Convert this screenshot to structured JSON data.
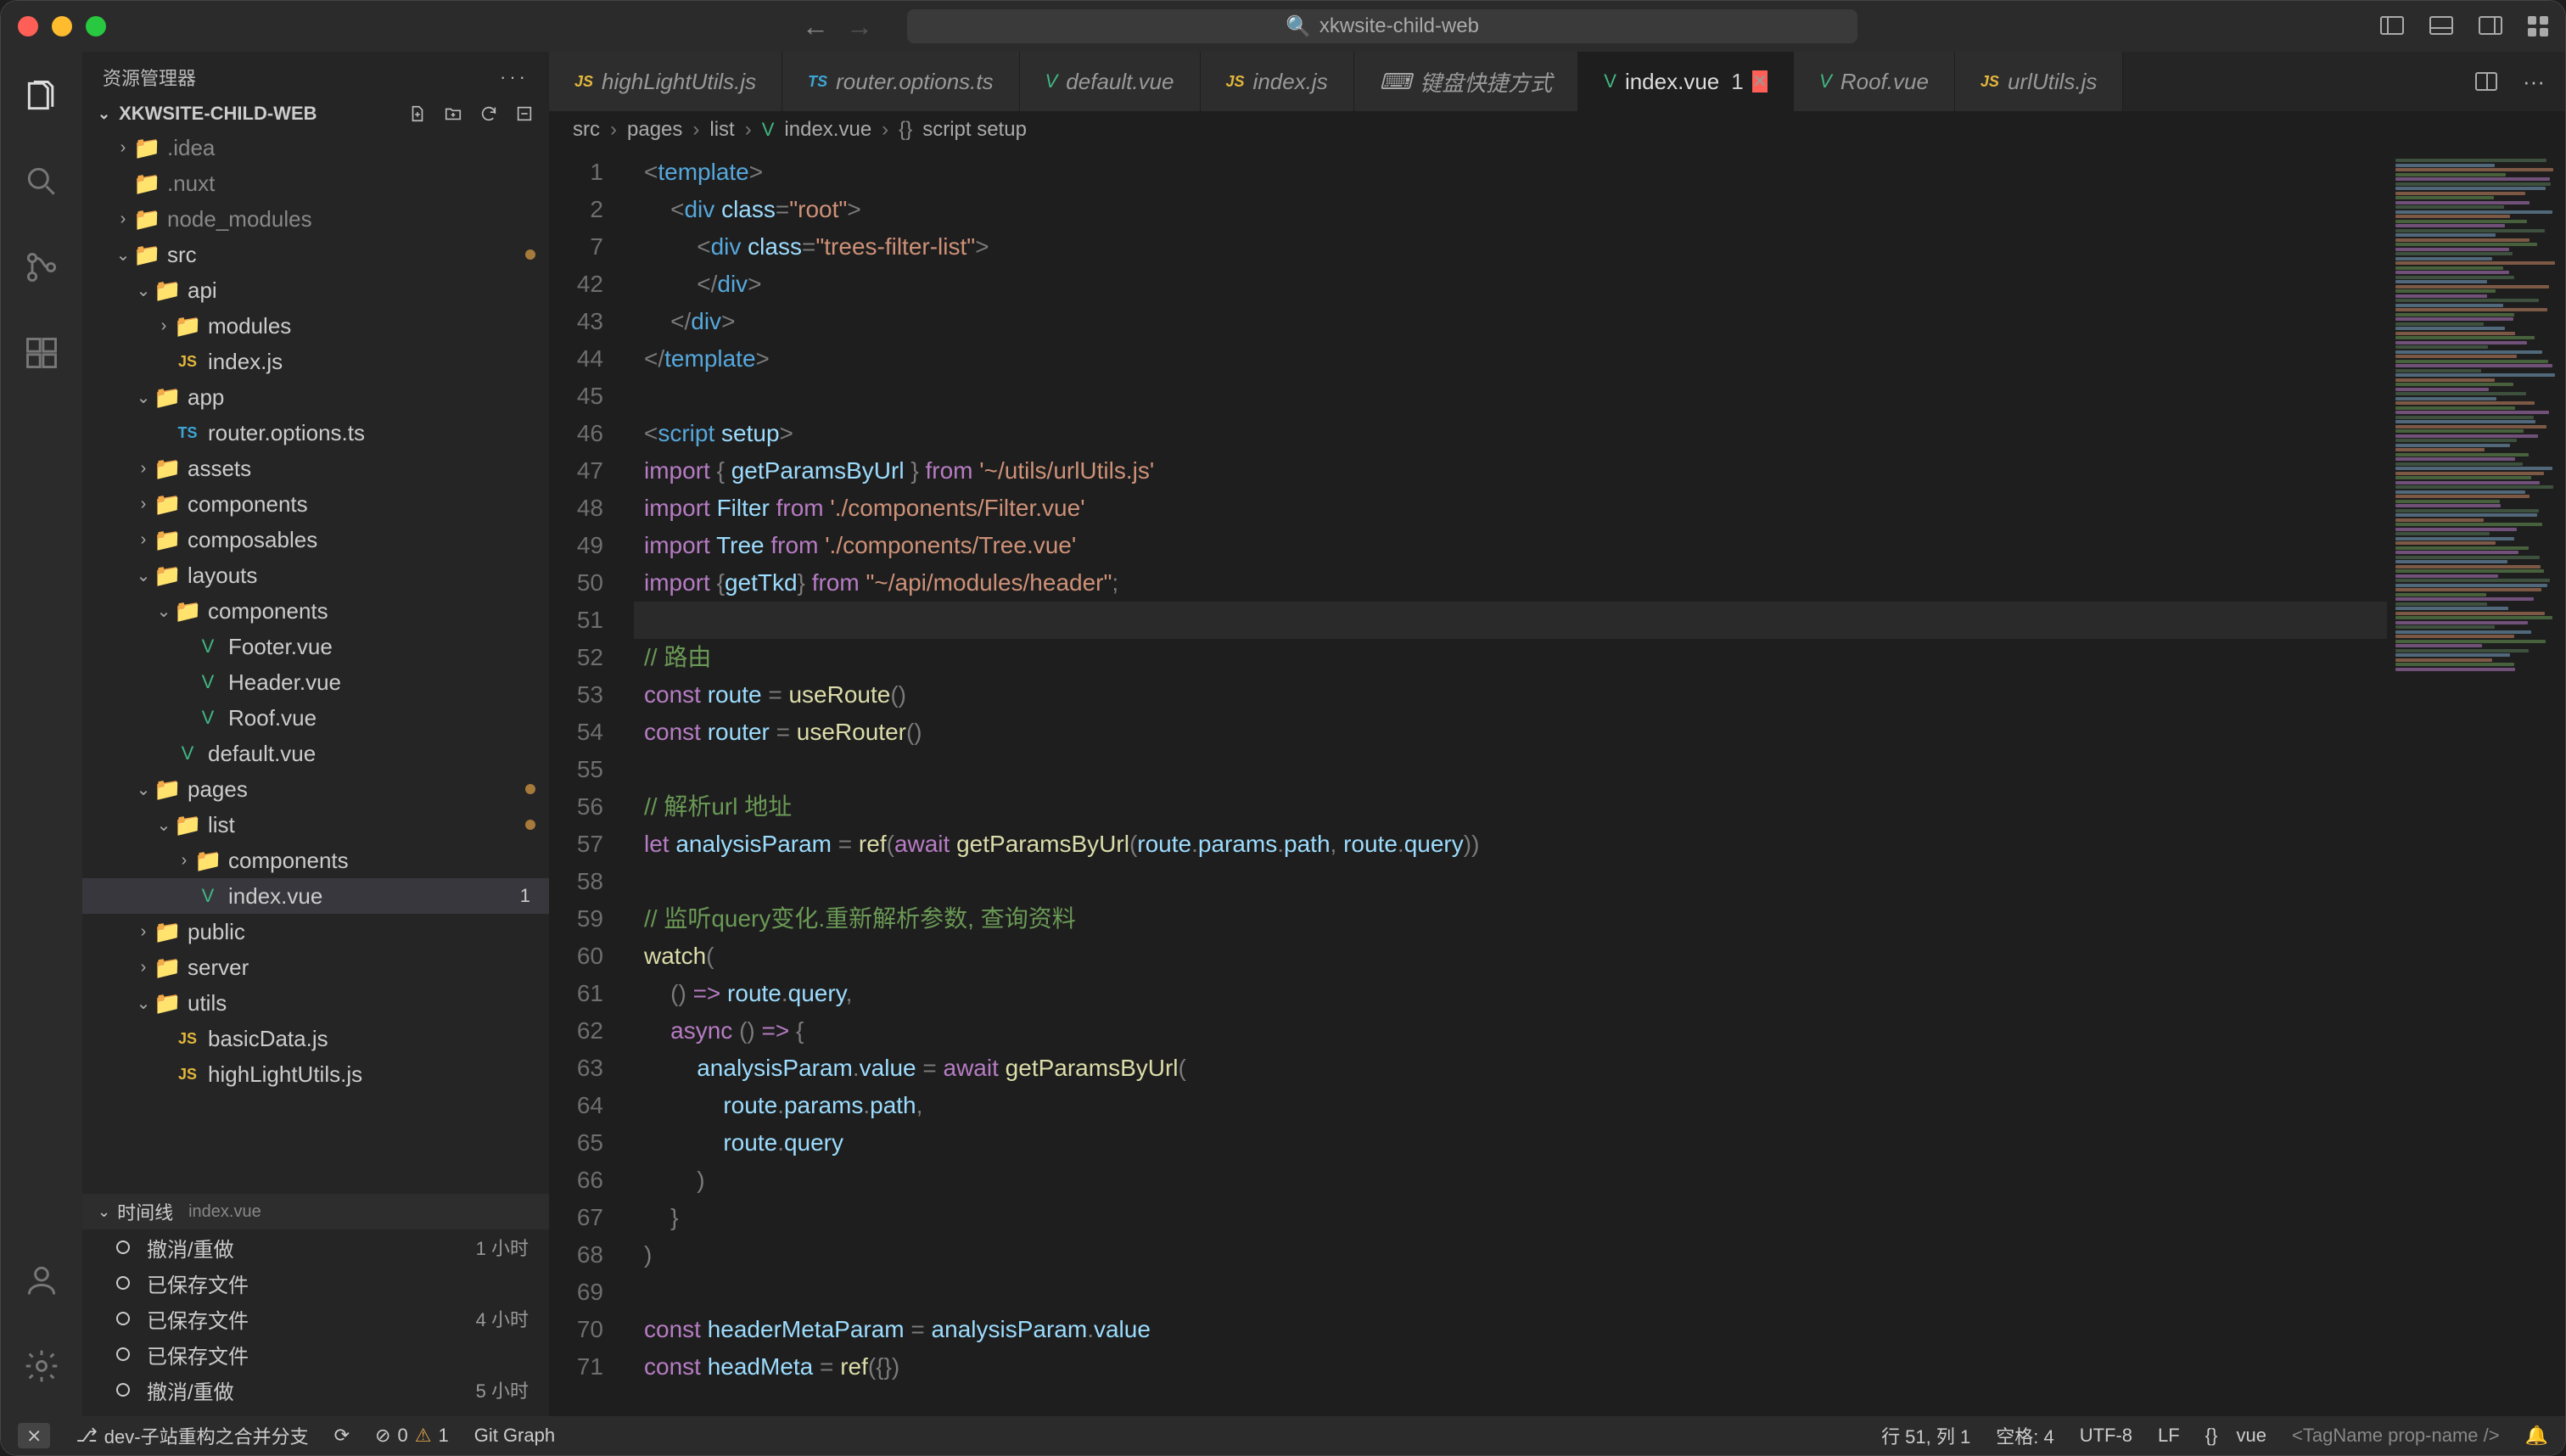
{
  "window": {
    "search_prefix": "🔍",
    "search_text": "xkwsite-child-web"
  },
  "sidebar": {
    "title": "资源管理器",
    "project": "XKWSITE-CHILD-WEB",
    "tree": [
      {
        "depth": 1,
        "chev": "›",
        "icon": "📁",
        "name": ".idea",
        "dim": true
      },
      {
        "depth": 1,
        "chev": "",
        "icon": "📁",
        "name": ".nuxt",
        "dim": true
      },
      {
        "depth": 1,
        "chev": "›",
        "icon": "📁",
        "name": "node_modules",
        "dim": true
      },
      {
        "depth": 1,
        "chev": "⌄",
        "icon": "📁",
        "name": "src",
        "mark": true,
        "color": "#7bbf5e"
      },
      {
        "depth": 2,
        "chev": "⌄",
        "icon": "📁",
        "name": "api"
      },
      {
        "depth": 3,
        "chev": "›",
        "icon": "📁",
        "name": "modules",
        "color": "#c76b6b"
      },
      {
        "depth": 3,
        "chev": "",
        "iconClass": "js-ic",
        "iconText": "JS",
        "name": "index.js"
      },
      {
        "depth": 2,
        "chev": "⌄",
        "icon": "📁",
        "name": "app"
      },
      {
        "depth": 3,
        "chev": "",
        "iconClass": "ts-ic",
        "iconText": "TS",
        "name": "router.options.ts"
      },
      {
        "depth": 2,
        "chev": "›",
        "icon": "📁",
        "name": "assets"
      },
      {
        "depth": 2,
        "chev": "›",
        "icon": "📁",
        "name": "components"
      },
      {
        "depth": 2,
        "chev": "›",
        "icon": "📁",
        "name": "composables"
      },
      {
        "depth": 2,
        "chev": "⌄",
        "icon": "📁",
        "name": "layouts",
        "color": "#d67a7a"
      },
      {
        "depth": 3,
        "chev": "⌄",
        "icon": "📁",
        "name": "components"
      },
      {
        "depth": 4,
        "chev": "",
        "iconClass": "vue-ic",
        "iconText": "V",
        "name": "Footer.vue"
      },
      {
        "depth": 4,
        "chev": "",
        "iconClass": "vue-ic",
        "iconText": "V",
        "name": "Header.vue"
      },
      {
        "depth": 4,
        "chev": "",
        "iconClass": "vue-ic",
        "iconText": "V",
        "name": "Roof.vue"
      },
      {
        "depth": 3,
        "chev": "",
        "iconClass": "vue-ic",
        "iconText": "V",
        "name": "default.vue"
      },
      {
        "depth": 2,
        "chev": "⌄",
        "icon": "📁",
        "name": "pages",
        "mark": true
      },
      {
        "depth": 3,
        "chev": "⌄",
        "icon": "📁",
        "name": "list",
        "mark": true
      },
      {
        "depth": 4,
        "chev": "›",
        "icon": "📁",
        "name": "components"
      },
      {
        "depth": 4,
        "chev": "",
        "iconClass": "vue-ic",
        "iconText": "V",
        "name": "index.vue",
        "selected": true,
        "badge": "1"
      },
      {
        "depth": 2,
        "chev": "›",
        "icon": "📁",
        "name": "public",
        "color": "#6aa66a"
      },
      {
        "depth": 2,
        "chev": "›",
        "icon": "📁",
        "name": "server"
      },
      {
        "depth": 2,
        "chev": "⌄",
        "icon": "📁",
        "name": "utils"
      },
      {
        "depth": 3,
        "chev": "",
        "iconClass": "js-ic",
        "iconText": "JS",
        "name": "basicData.js"
      },
      {
        "depth": 3,
        "chev": "",
        "iconClass": "js-ic",
        "iconText": "JS",
        "name": "highLightUtils.js"
      }
    ],
    "timeline": {
      "title": "时间线",
      "file": "index.vue",
      "items": [
        {
          "label": "撤消/重做",
          "when": "1 小时"
        },
        {
          "label": "已保存文件",
          "when": ""
        },
        {
          "label": "已保存文件",
          "when": "4 小时"
        },
        {
          "label": "已保存文件",
          "when": ""
        },
        {
          "label": "撤消/重做",
          "when": "5 小时"
        }
      ]
    }
  },
  "tabs": [
    {
      "iconClass": "js-ic",
      "iconText": "JS",
      "label": "highLightUtils.js"
    },
    {
      "iconClass": "ts-ic",
      "iconText": "TS",
      "label": "router.options.ts"
    },
    {
      "iconClass": "vue-ic",
      "iconText": "V",
      "label": "default.vue"
    },
    {
      "iconClass": "js-ic",
      "iconText": "JS",
      "label": "index.js"
    },
    {
      "iconClass": "kb-ic",
      "iconText": "⌨",
      "label": "键盘快捷方式"
    },
    {
      "iconClass": "vue-ic",
      "iconText": "V",
      "label": "index.vue",
      "mod": "1",
      "active": true,
      "close": true
    },
    {
      "iconClass": "vue-ic",
      "iconText": "V",
      "label": "Roof.vue"
    },
    {
      "iconClass": "js-ic",
      "iconText": "JS",
      "label": "urlUtils.js"
    }
  ],
  "breadcrumbs": [
    "src",
    "pages",
    "list",
    "index.vue",
    "script setup"
  ],
  "breadcrumbs_last_icon": "{}",
  "editor": {
    "gutter": [
      "1",
      "2",
      "7",
      "42",
      "43",
      "44",
      "45",
      "46",
      "47",
      "48",
      "49",
      "50",
      "51",
      "52",
      "53",
      "54",
      "55",
      "56",
      "57",
      "58",
      "59",
      "60",
      "61",
      "62",
      "63",
      "64",
      "65",
      "66",
      "67",
      "68",
      "69",
      "70",
      "71"
    ],
    "lines": [
      "<span class='p'>&lt;</span><span class='t'>template</span><span class='p'>&gt;</span>",
      "    <span class='p'>&lt;</span><span class='t'>div</span> <span class='a'>class</span><span class='p'>=</span><span class='s'>\"root\"</span><span class='p'>&gt;</span>",
      "        <span class='p'>&lt;</span><span class='t'>div</span> <span class='a'>class</span><span class='p'>=</span><span class='s'>\"trees-filter-list\"</span><span class='p'>&gt;</span>",
      "        <span class='p'>&lt;/</span><span class='t'>div</span><span class='p'>&gt;</span>",
      "    <span class='p'>&lt;/</span><span class='t'>div</span><span class='p'>&gt;</span>",
      "<span class='p'>&lt;/</span><span class='t'>template</span><span class='p'>&gt;</span>",
      "",
      "<span class='p'>&lt;</span><span class='t'>script</span> <span class='a'>setup</span><span class='p'>&gt;</span>",
      "<span class='k'>import</span> <span class='p'>{</span> <span class='v'>getParamsByUrl</span> <span class='p'>}</span> <span class='k'>from</span> <span class='s'>'~/utils/urlUtils.js'</span>",
      "<span class='k'>import</span> <span class='v'>Filter</span> <span class='k'>from</span> <span class='s'>'./components/Filter.vue'</span>",
      "<span class='k'>import</span> <span class='v'>Tree</span> <span class='k'>from</span> <span class='s'>'./components/Tree.vue'</span>",
      "<span class='k'>import</span> <span class='p'>{</span><span class='v'>getTkd</span><span class='p'>}</span> <span class='k'>from</span> <span class='s'>\"~/api/modules/header\"</span><span class='p'>;</span>",
      "",
      "<span class='c'>// 路由</span>",
      "<span class='k'>const</span> <span class='v'>route</span> <span class='p'>=</span> <span class='f'>useRoute</span><span class='p'>()</span>",
      "<span class='k'>const</span> <span class='v'>router</span> <span class='p'>=</span> <span class='f'>useRouter</span><span class='p'>()</span>",
      "",
      "<span class='c'>// 解析url 地址</span>",
      "<span class='k'>let</span> <span class='v'>analysisParam</span> <span class='p'>=</span> <span class='f'>ref</span><span class='p'>(</span><span class='k'>await</span> <span class='f'>getParamsByUrl</span><span class='p'>(</span><span class='v'>route</span><span class='p'>.</span><span class='v'>params</span><span class='p'>.</span><span class='v'>path</span><span class='p'>,</span> <span class='v'>route</span><span class='p'>.</span><span class='v'>query</span><span class='p'>))</span>",
      "",
      "<span class='c'>// 监听query变化.重新解析参数, 查询资料</span>",
      "<span class='f'>watch</span><span class='p'>(</span>",
      "    <span class='p'>()</span> <span class='k'>=&gt;</span> <span class='v'>route</span><span class='p'>.</span><span class='v'>query</span><span class='p'>,</span>",
      "    <span class='k'>async</span> <span class='p'>()</span> <span class='k'>=&gt;</span> <span class='p'>{</span>",
      "        <span class='v'>analysisParam</span><span class='p'>.</span><span class='v'>value</span> <span class='p'>=</span> <span class='k'>await</span> <span class='f'>getParamsByUrl</span><span class='p'>(</span>",
      "            <span class='v'>route</span><span class='p'>.</span><span class='v'>params</span><span class='p'>.</span><span class='v'>path</span><span class='p'>,</span>",
      "            <span class='v'>route</span><span class='p'>.</span><span class='v'>query</span>",
      "        <span class='p'>)</span>",
      "    <span class='p'>}</span>",
      "<span class='p'>)</span>",
      "",
      "<span class='k'>const</span> <span class='v'>headerMetaParam</span> <span class='p'>=</span> <span class='v'>analysisParam</span><span class='p'>.</span><span class='v'>value</span>",
      "<span class='k'>const</span> <span class='v'>headMeta</span> <span class='p'>=</span> <span class='f'>ref</span><span class='p'>({})</span>"
    ],
    "current_line_index": 12
  },
  "status": {
    "remote_icon": "⨯",
    "branch_icon": "⎇",
    "branch": "dev-子站重构之合并分支",
    "sync": "⟳",
    "errors": "0",
    "warnings": "1",
    "git_graph": "Git Graph",
    "position": "行 51, 列 1",
    "spaces": "空格: 4",
    "encoding": "UTF-8",
    "eol": "LF",
    "lang_icon": "{}",
    "lang": "vue",
    "tag_hint": "<TagName prop-name />",
    "bell": "🔔"
  }
}
